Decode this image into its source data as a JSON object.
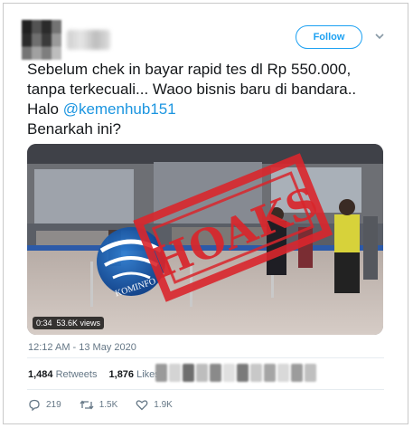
{
  "tweet": {
    "text_main": "Sebelum chek in bayar rapid tes dl Rp 550.000, tanpa terkecuali... Waoo bisnis baru di bandara.. Halo ",
    "mention": "@kemenhub151",
    "text_end": "Benarkah ini?",
    "timestamp": "12:12 AM - 13 May 2020"
  },
  "header": {
    "follow_label": "Follow",
    "avatar_icon": "blurred-avatar",
    "menu_icon": "chevron-down-icon"
  },
  "media": {
    "duration": "0:34",
    "views": "53.6K views",
    "stamp_text": "HOAKS",
    "logo_text": "KOMINFO",
    "stamp_color": "#d9262c"
  },
  "stats": {
    "retweets_count": "1,484",
    "retweets_label": "Retweets",
    "likes_count": "1,876",
    "likes_label": "Likes"
  },
  "actions": {
    "reply_count": "219",
    "retweet_count": "1.5K",
    "like_count": "1.9K"
  },
  "colors": {
    "accent": "#1da1f2",
    "mention": "#1b95e0",
    "muted": "#657786"
  }
}
